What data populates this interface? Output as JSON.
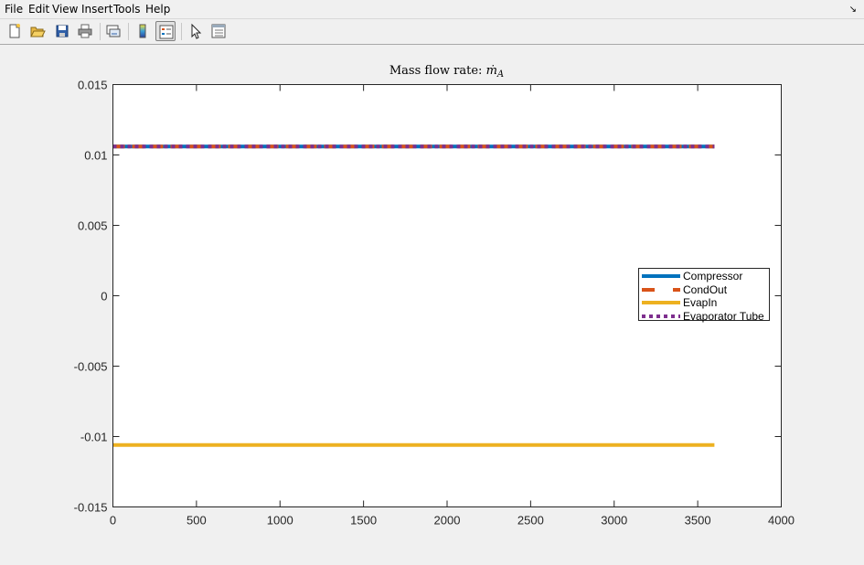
{
  "menu": {
    "file": "File",
    "edit": "Edit",
    "view": "View",
    "insert": "Insert",
    "tools": "Tools",
    "help": "Help"
  },
  "toolbar": {
    "icons": [
      "new-figure-icon",
      "open-file-icon",
      "save-figure-icon",
      "print-figure-icon",
      "link-plot-icon",
      "colorbar-icon",
      "legend-icon",
      "edit-plot-icon",
      "property-inspector-icon"
    ]
  },
  "chart_data": {
    "type": "line",
    "title_text": "Mass flow rate: ",
    "title_symbol": "ṁ",
    "title_subscript": "A",
    "xlim": [
      0,
      4000
    ],
    "ylim": [
      -0.015,
      0.015
    ],
    "xticks": [
      0,
      500,
      1000,
      1500,
      2000,
      2500,
      3000,
      3500,
      4000
    ],
    "xtick_labels": [
      "0",
      "500",
      "1000",
      "1500",
      "2000",
      "2500",
      "3000",
      "3500",
      "4000"
    ],
    "yticks": [
      0.015,
      0.01,
      0.005,
      0,
      -0.005,
      -0.01,
      -0.015
    ],
    "ytick_labels": [
      "0.015",
      "0.01",
      "0.005",
      "0",
      "-0.005",
      "-0.01",
      "-0.015"
    ],
    "grid": false,
    "legend_position": "right",
    "series": [
      {
        "name": "Compressor",
        "color": "#0072bd",
        "style": "solid",
        "x": [
          0,
          3600
        ],
        "y": [
          0.0106,
          0.0106
        ]
      },
      {
        "name": "CondOut",
        "color": "#d95319",
        "style": "dashed",
        "x": [
          0,
          3600
        ],
        "y": [
          0.0106,
          0.0106
        ]
      },
      {
        "name": "EvapIn",
        "color": "#edb120",
        "style": "solid",
        "x": [
          0,
          3600
        ],
        "y": [
          -0.0106,
          -0.0106
        ]
      },
      {
        "name": "Evaporator Tube",
        "color": "#7e2f8e",
        "style": "dotted",
        "x": [
          0,
          3600
        ],
        "y": [
          0.0106,
          0.0106
        ]
      }
    ]
  }
}
